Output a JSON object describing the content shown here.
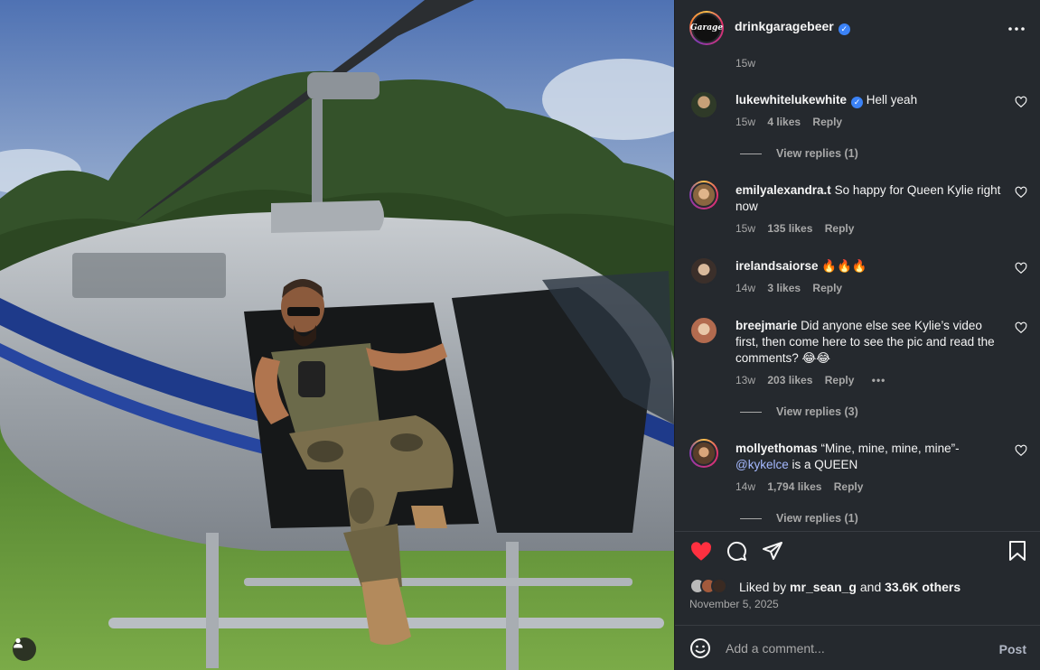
{
  "post": {
    "author": "drinkgaragebeer",
    "author_avatar_text": "Garage",
    "posted_ago": "15w",
    "liked_by_prefix": "Liked by ",
    "liked_by_user": "mr_sean_g",
    "liked_by_and": " and ",
    "liked_by_others": "33.6K others",
    "date": "November 5, 2025",
    "like_active_color": "#ff3040"
  },
  "comments": [
    {
      "user": "lukewhitelukewhite",
      "verified": true,
      "text": "Hell yeah",
      "time": "15w",
      "likes": "4 likes",
      "reply": "Reply",
      "view_replies": "View replies (1)"
    },
    {
      "user": "emilyalexandra.t",
      "text": "So happy for Queen Kylie right now",
      "time": "15w",
      "likes": "135 likes",
      "reply": "Reply"
    },
    {
      "user": "irelandsaiorse",
      "text": "🔥🔥🔥",
      "time": "14w",
      "likes": "3 likes",
      "reply": "Reply"
    },
    {
      "user": "breejmarie",
      "text": "Did anyone else see Kylie’s video first, then come here to see the pic and read the comments? 😂😂",
      "time": "13w",
      "likes": "203 likes",
      "reply": "Reply",
      "more": "•••",
      "view_replies": "View replies (3)"
    },
    {
      "user": "mollyethomas",
      "text": "“Mine, mine, mine, mine”-",
      "mention": "@kykelce",
      "text_after": " is a QUEEN",
      "time": "14w",
      "likes": "1,794 likes",
      "reply": "Reply",
      "view_replies": "View replies (1)"
    }
  ],
  "composer": {
    "placeholder": "Add a comment...",
    "post_label": "Post"
  },
  "icons": {
    "more": "more-horizontal-icon",
    "heart": "heart-icon",
    "comment": "comment-icon",
    "share": "send-icon",
    "save": "bookmark-icon",
    "emoji": "emoji-icon",
    "user_tag": "user-icon"
  }
}
